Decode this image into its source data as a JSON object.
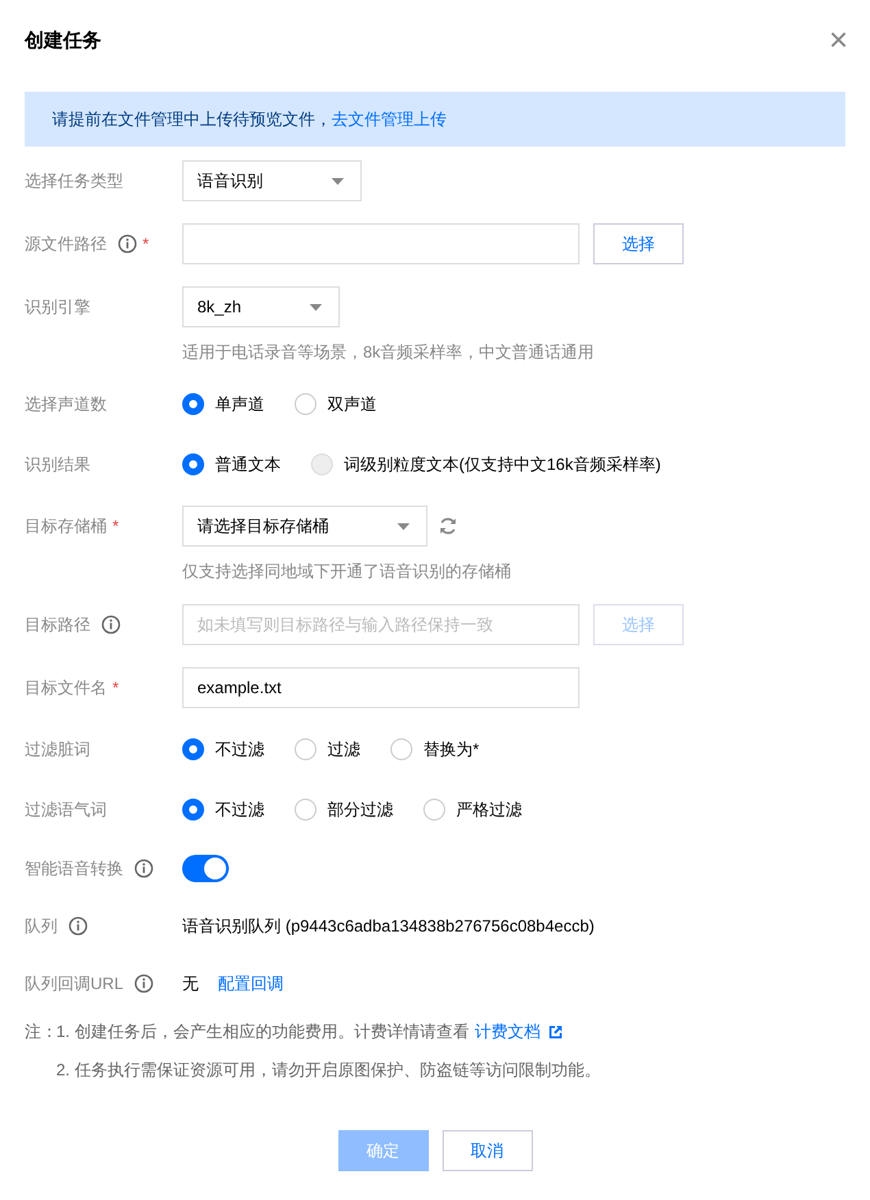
{
  "dialog": {
    "title": "创建任务",
    "close": "×"
  },
  "banner": {
    "text": "请提前在文件管理中上传待预览文件，",
    "link": "去文件管理上传"
  },
  "rows": [
    {
      "kind": "select",
      "label": "选择任务类型",
      "info": false,
      "value": "语音识别"
    },
    {
      "kind": "input_button",
      "label": "源文件路径",
      "info": true,
      "required_mark": "*",
      "value": "",
      "button": "选择",
      "button_disabled": false
    },
    {
      "kind": "select",
      "label": "识别引擎",
      "info": false,
      "value": "8k_zh",
      "hint": "适用于电话录音等场景，8k音频采样率，中文普通话通用"
    },
    {
      "kind": "radio",
      "label": "选择声道数",
      "info": false,
      "options": [
        {
          "label": "单声道",
          "selected": true,
          "disabled": false
        },
        {
          "label": "双声道",
          "selected": false,
          "disabled": false
        }
      ]
    },
    {
      "kind": "radio",
      "label": "识别结果",
      "info": false,
      "options": [
        {
          "label": "普通文本",
          "selected": true,
          "disabled": false
        },
        {
          "label": "词级别粒度文本(仅支持中文16k音频采样率)",
          "selected": false,
          "disabled": true
        }
      ]
    },
    {
      "kind": "select",
      "label": "目标存储桶",
      "info": false,
      "required_mark": "*",
      "value": "请选择目标存储桶",
      "refresh": true,
      "hint": "仅支持选择同地域下开通了语音识别的存储桶"
    },
    {
      "kind": "input_button",
      "label": "目标路径",
      "info": true,
      "placeholder": "如未填写则目标路径与输入路径保持一致",
      "button": "选择",
      "button_disabled": true
    },
    {
      "kind": "input",
      "label": "目标文件名",
      "info": false,
      "required_mark": "*",
      "value": "example.txt"
    },
    {
      "kind": "radio",
      "label": "过滤脏词",
      "info": false,
      "options": [
        {
          "label": "不过滤",
          "selected": true,
          "disabled": false
        },
        {
          "label": "过滤",
          "selected": false,
          "disabled": false
        },
        {
          "label": "替换为*",
          "selected": false,
          "disabled": false
        }
      ]
    },
    {
      "kind": "radio",
      "label": "过滤语气词",
      "info": false,
      "options": [
        {
          "label": "不过滤",
          "selected": true,
          "disabled": false
        },
        {
          "label": "部分过滤",
          "selected": false,
          "disabled": false
        },
        {
          "label": "严格过滤",
          "selected": false,
          "disabled": false
        }
      ]
    },
    {
      "kind": "switch",
      "label": "智能语音转换",
      "info": true,
      "on": true
    },
    {
      "kind": "text",
      "label": "队列",
      "info": true,
      "value": "语音识别队列 (p9443c6adba134838b276756c08b4eccb)"
    },
    {
      "kind": "text_link",
      "label": "队列回调URL",
      "info": true,
      "value": "无",
      "link": "配置回调"
    }
  ],
  "notes": {
    "label": "注：",
    "items": [
      {
        "text": "1. 创建任务后，会产生相应的功能费用。计费详情请查看",
        "link": "计费文档"
      },
      {
        "text": "2. 任务执行需保证资源可用，请勿开启原图保护、防盗链等访问限制功能。"
      }
    ]
  },
  "buttons": [
    {
      "label": "确定",
      "kind": "primary",
      "disabled": true
    },
    {
      "label": "取消",
      "kind": "default",
      "disabled": false
    }
  ]
}
